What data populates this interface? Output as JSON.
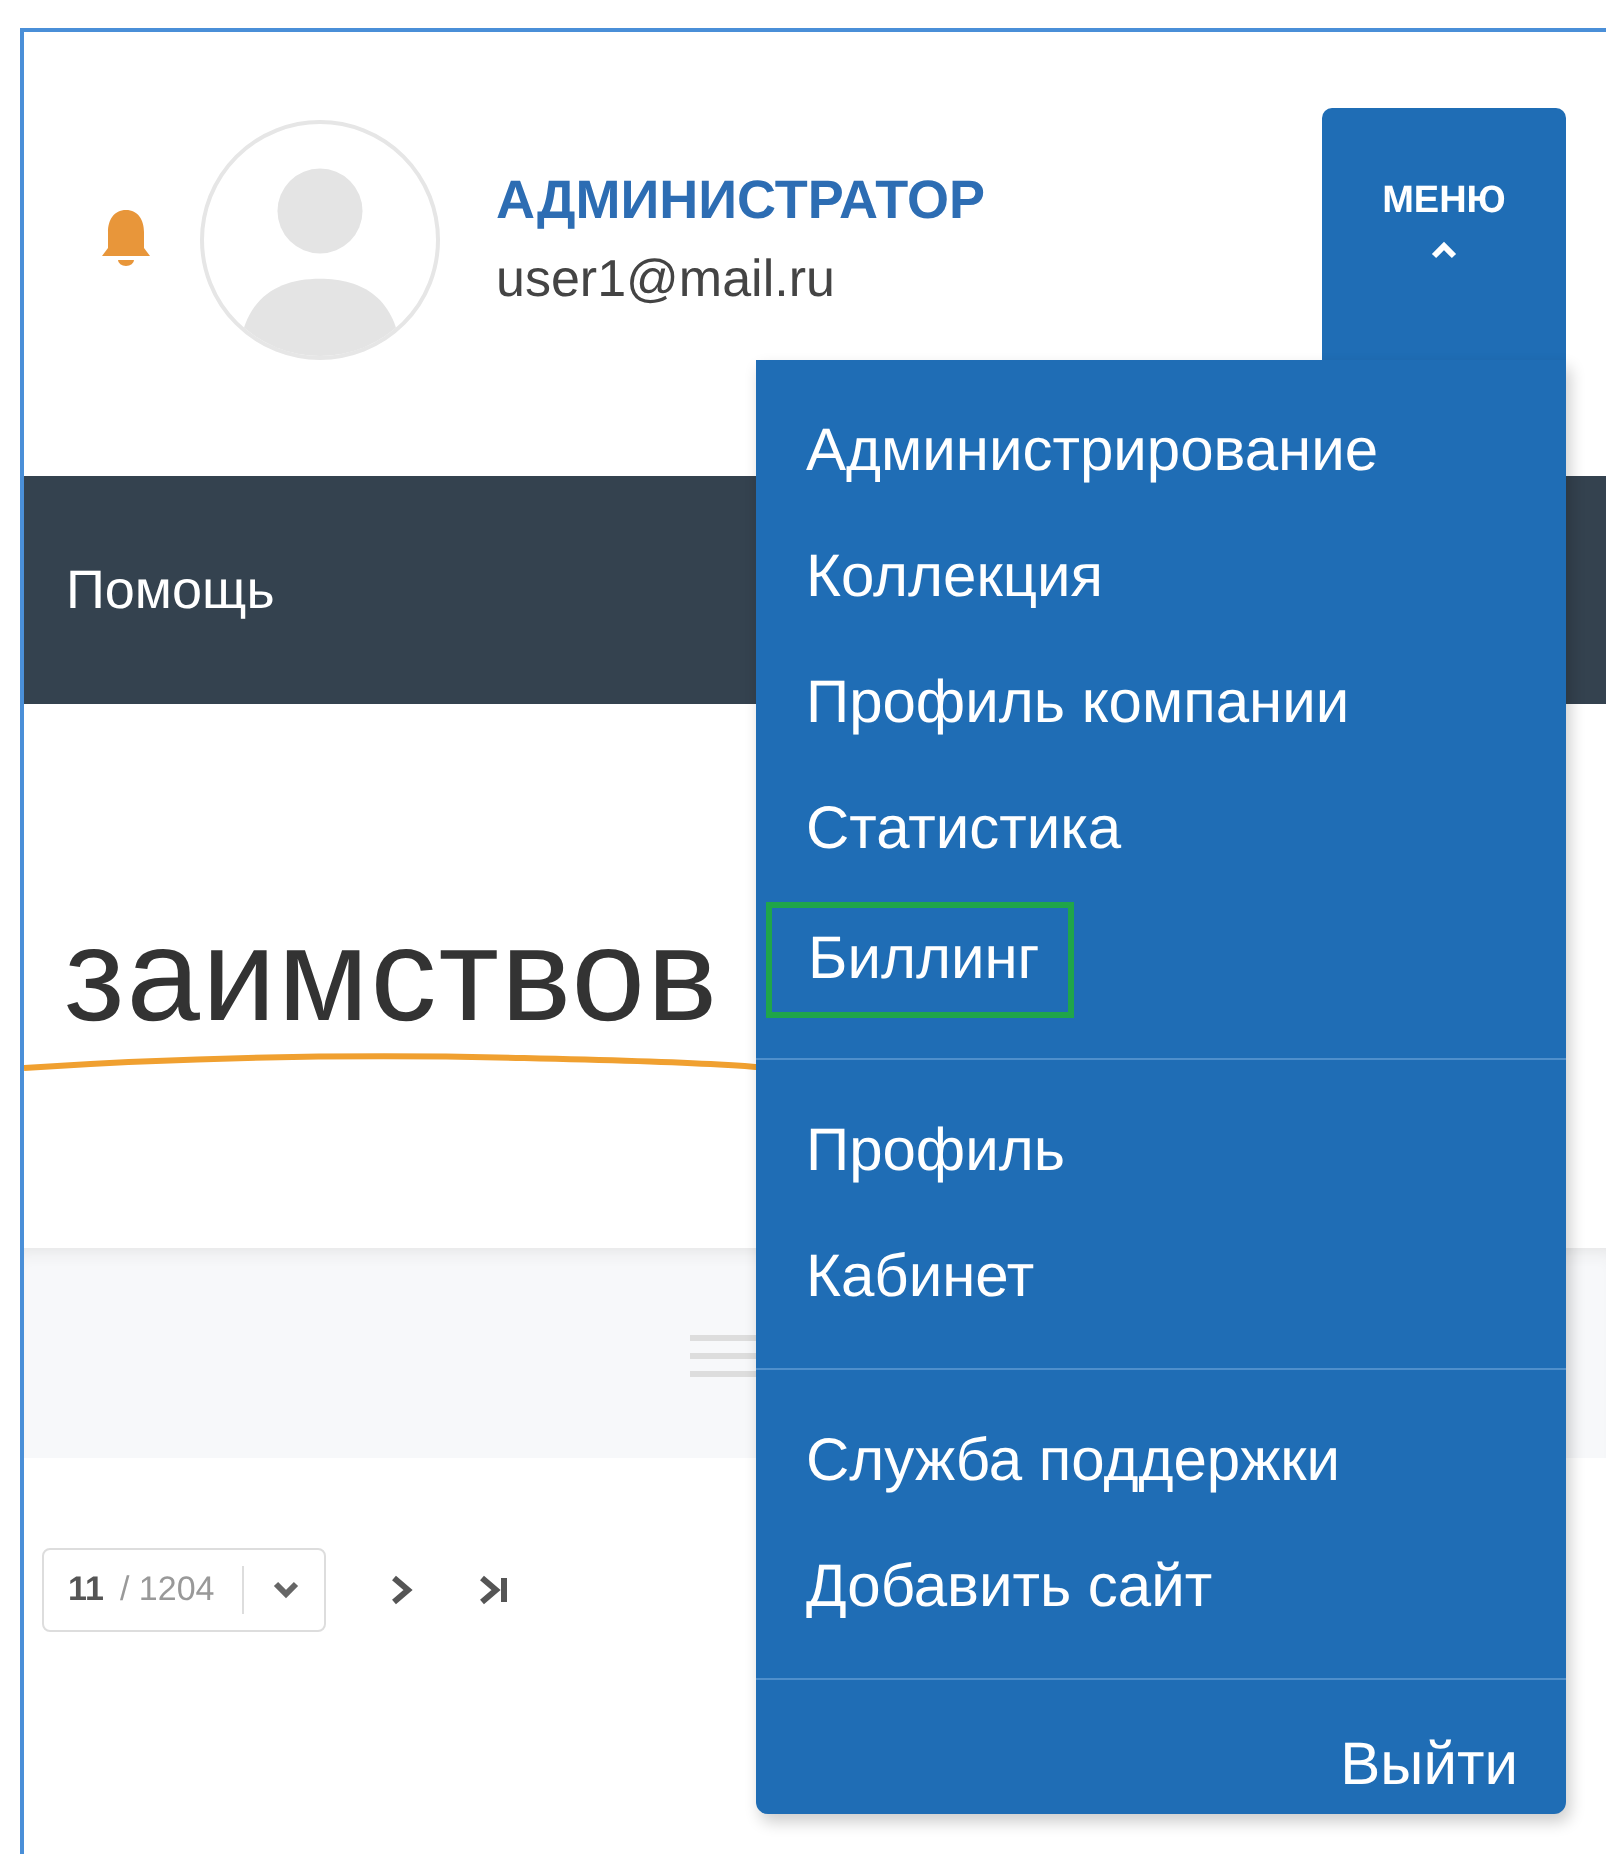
{
  "header": {
    "user_role": "АДМИНИСТРАТОР",
    "user_email": "user1@mail.ru",
    "menu_button": {
      "label": "МЕНЮ",
      "expanded": true
    }
  },
  "nav": {
    "items": [
      "Помощь"
    ]
  },
  "page_title": "заимствов",
  "pagination": {
    "current": "11",
    "total": "/ 1204"
  },
  "menu": {
    "groups": [
      [
        {
          "label": "Администрирование",
          "highlighted": false
        },
        {
          "label": "Коллекция",
          "highlighted": false
        },
        {
          "label": "Профиль компании",
          "highlighted": false
        },
        {
          "label": "Статистика",
          "highlighted": false
        },
        {
          "label": "Биллинг",
          "highlighted": true
        }
      ],
      [
        {
          "label": "Профиль",
          "highlighted": false
        },
        {
          "label": "Кабинет",
          "highlighted": false
        }
      ],
      [
        {
          "label": "Служба поддержки",
          "highlighted": false
        },
        {
          "label": "Добавить сайт",
          "highlighted": false
        }
      ]
    ],
    "logout": "Выйти"
  }
}
